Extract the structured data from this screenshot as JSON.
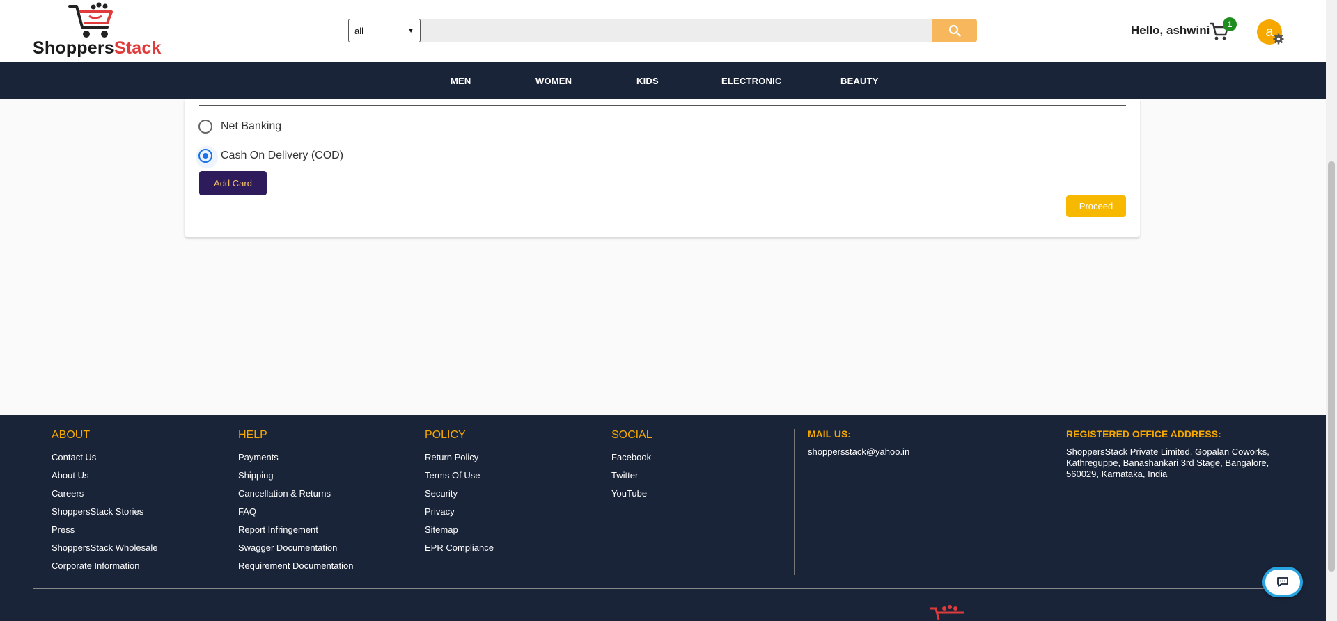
{
  "brand": {
    "name_part1": "Shoppers",
    "name_part2": "Stack"
  },
  "search": {
    "category_selected": "all",
    "placeholder": ""
  },
  "user": {
    "greeting": "Hello, ashwini",
    "cart_count": "1",
    "avatar_initial": "a"
  },
  "nav": {
    "items": [
      "MEN",
      "WOMEN",
      "KIDS",
      "ELECTRONIC",
      "BEAUTY"
    ]
  },
  "payment": {
    "options": [
      {
        "label": "Net Banking",
        "selected": false
      },
      {
        "label": "Cash On Delivery (COD)",
        "selected": true
      }
    ],
    "add_card_label": "Add Card",
    "proceed_label": "Proceed"
  },
  "footer": {
    "columns": [
      {
        "heading": "ABOUT",
        "links": [
          "Contact Us",
          "About Us",
          "Careers",
          "ShoppersStack Stories",
          "Press",
          "ShoppersStack Wholesale",
          "Corporate Information"
        ]
      },
      {
        "heading": "HELP",
        "links": [
          "Payments",
          "Shipping",
          "Cancellation & Returns",
          "FAQ",
          "Report Infringement",
          "Swagger Documentation",
          "Requirement Documentation"
        ]
      },
      {
        "heading": "POLICY",
        "links": [
          "Return Policy",
          "Terms Of Use",
          "Security",
          "Privacy",
          "Sitemap",
          "EPR Compliance"
        ]
      },
      {
        "heading": "SOCIAL",
        "links": [
          "Facebook",
          "Twitter",
          "YouTube"
        ]
      }
    ],
    "mail": {
      "heading": "MAIL US:",
      "email": "shoppersstack@yahoo.in"
    },
    "office": {
      "heading": "REGISTERED OFFICE ADDRESS:",
      "address": "ShoppersStack Private Limited, Gopalan Coworks, Kathreguppe, Banashankari 3rd Stage, Bangalore, 560029, Karnataka, India"
    }
  },
  "colors": {
    "nav_bg": "#1a2438",
    "accent": "#f6a800",
    "button_primary": "#2d1b5c",
    "proceed": "#f7b800",
    "search_btn": "#f7b75d"
  },
  "icons": [
    "cart-logo-icon",
    "search-icon",
    "cart-icon",
    "gear-icon",
    "chat-icon"
  ]
}
